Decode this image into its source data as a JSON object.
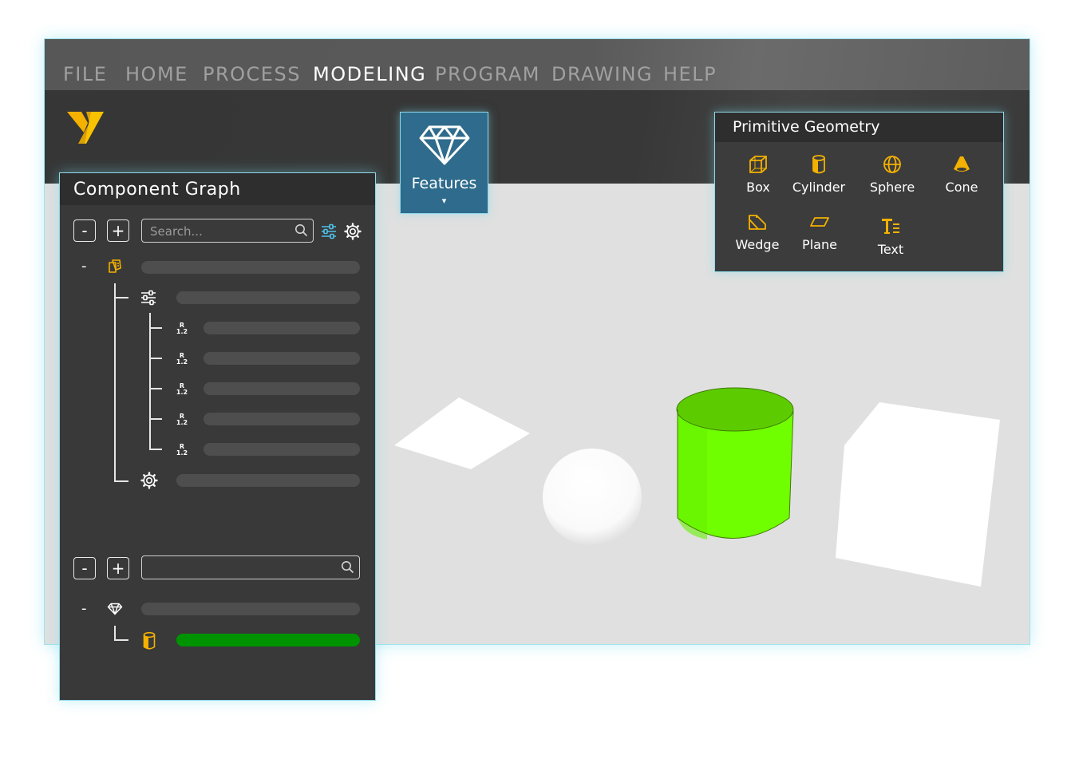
{
  "menu": {
    "items": [
      "FILE",
      "HOME",
      "PROCESS",
      "MODELING",
      "PROGRAM",
      "DRAWING",
      "HELP"
    ],
    "active": "MODELING"
  },
  "logo": {
    "icon": "v-logo-icon",
    "color": "#f4b100"
  },
  "features": {
    "label": "Features",
    "caret": "▾",
    "icon": "diamond-icon"
  },
  "primitive_geometry": {
    "title": "Primitive Geometry",
    "icon_color": "#f4b100",
    "items": [
      {
        "label": "Box",
        "icon": "box-icon"
      },
      {
        "label": "Cylinder",
        "icon": "cylinder-icon"
      },
      {
        "label": "Sphere",
        "icon": "sphere-icon"
      },
      {
        "label": "Cone",
        "icon": "cone-icon"
      },
      {
        "label": "Wedge",
        "icon": "wedge-icon"
      },
      {
        "label": "Plane",
        "icon": "plane-icon"
      },
      {
        "label": "Text",
        "icon": "text-icon"
      }
    ]
  },
  "component_graph": {
    "title": "Component Graph",
    "collapse_label": "-",
    "expand_label": "+",
    "search_placeholder": "Search...",
    "tree_toggle": "-",
    "parameter_label": "R 1.2",
    "lower_search_placeholder": "",
    "selected_color": "#009300"
  },
  "viewport": {
    "background": "#e0e0e0",
    "objects": [
      "plane",
      "sphere",
      "cylinder",
      "box"
    ],
    "selected_color": "#72ff00"
  }
}
